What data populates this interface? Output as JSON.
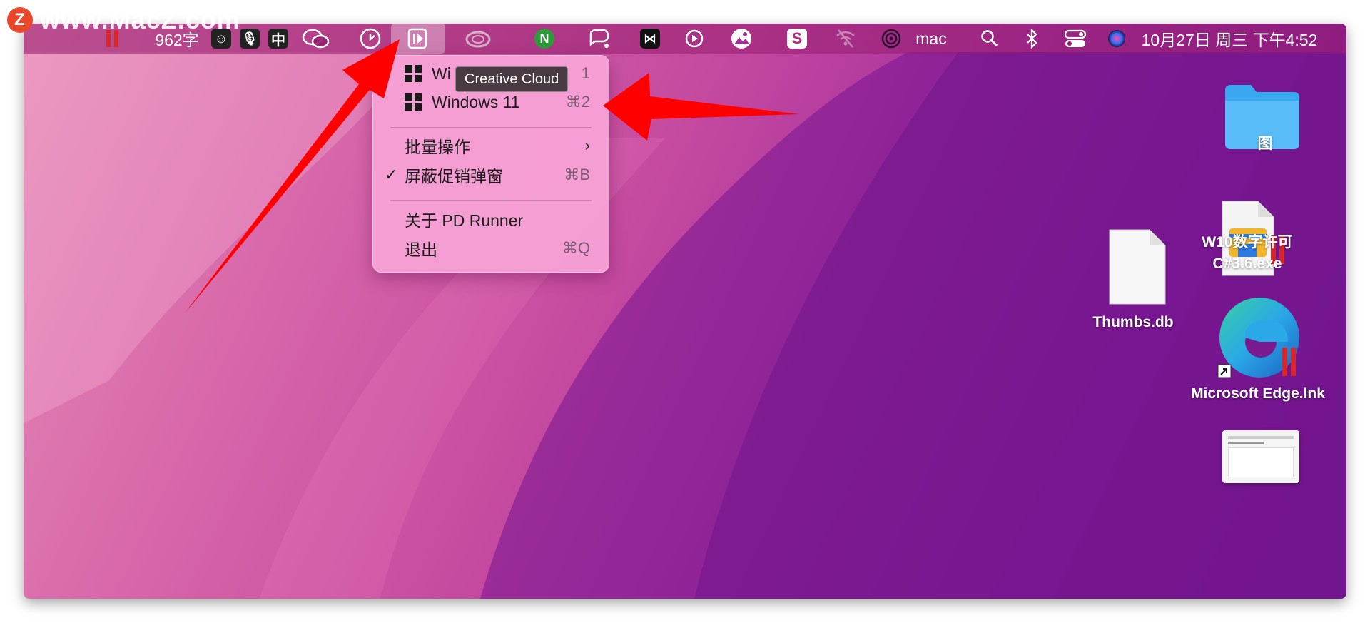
{
  "watermark": {
    "logo_letter": "Z",
    "text": "www.MacZ.com"
  },
  "menubar": {
    "word_count": "962字",
    "input_method": "中",
    "user": "mac",
    "datetime": "10月27日 周三 下午4:52",
    "icons": [
      "parallels-icon",
      "emoji-icon",
      "microphone-icon",
      "wechat-icon",
      "clock-icon",
      "pd-runner-icon",
      "creative-cloud-icon",
      "notion-icon",
      "capcut-icon",
      "play-icon",
      "photos-icon",
      "sogou-icon",
      "wifi-off-icon",
      "airdrop-icon",
      "search-icon",
      "bluetooth-icon",
      "control-center-icon",
      "siri-icon"
    ]
  },
  "tooltip": {
    "text": "Creative Cloud"
  },
  "menu": {
    "items": [
      {
        "label": "Wi",
        "shortcut": "1"
      },
      {
        "label": "Windows 11",
        "shortcut": "⌘2"
      },
      {
        "label": "批量操作",
        "submenu": "›"
      },
      {
        "label": "屏蔽促销弹窗",
        "shortcut": "⌘B",
        "checked": "✓"
      },
      {
        "label": "关于 PD Runner"
      },
      {
        "label": "退出",
        "shortcut": "⌘Q"
      }
    ]
  },
  "desktop": {
    "items": [
      {
        "label": "图"
      },
      {
        "label_line1": "W10数字许可",
        "label_line2": "C#3.6.exe"
      },
      {
        "label": "Thumbs.db"
      },
      {
        "label": "Microsoft Edge.lnk"
      }
    ]
  }
}
